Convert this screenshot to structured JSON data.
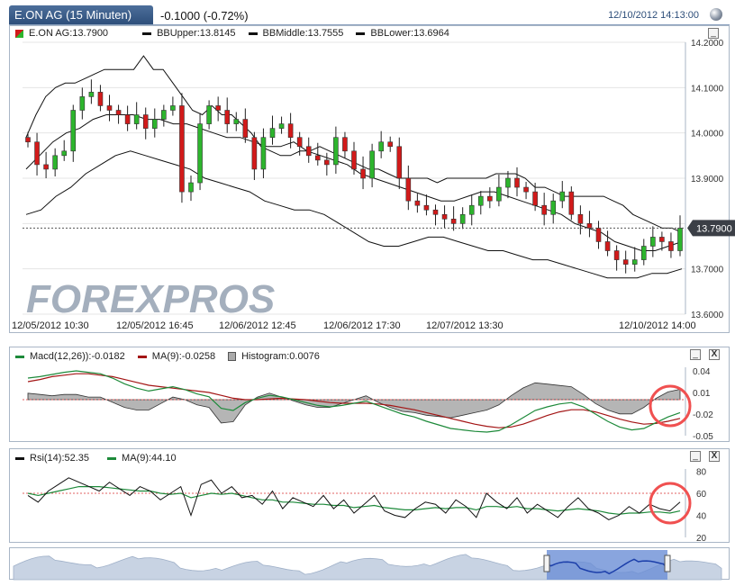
{
  "header": {
    "title": "E.ON AG (15 Minuten)",
    "change": "-0.1000 (-0.72%)",
    "timestamp": "12/10/2012 14:13:00"
  },
  "main": {
    "legend": [
      {
        "label": "E.ON AG:13.7900"
      },
      {
        "label": "BBUpper:13.8145"
      },
      {
        "label": "BBMiddle:13.7555"
      },
      {
        "label": "BBLower:13.6964"
      }
    ],
    "yticks": [
      "14.2000",
      "14.1000",
      "14.0000",
      "13.9000",
      "13.7000",
      "13.6000"
    ],
    "xticks": [
      "12/05/2012 10:30",
      "12/05/2012 16:45",
      "12/06/2012 12:45",
      "12/06/2012 17:30",
      "12/07/2012 13:30",
      "12/10/2012 14:00"
    ],
    "last_price": "13.7900",
    "watermark": "FOREXPROS",
    "minimize": "_"
  },
  "macd": {
    "legend": [
      {
        "label": "Macd(12,26)):-0.0182"
      },
      {
        "label": "MA(9):-0.0258"
      },
      {
        "label": "Histogram:0.0076"
      }
    ],
    "yticks": [
      "0.04",
      "0.01",
      "-0.02",
      "-0.05"
    ],
    "minimize": "_",
    "close": "X"
  },
  "rsi": {
    "legend": [
      {
        "label": "Rsi(14):52.35"
      },
      {
        "label": "MA(9):44.10"
      }
    ],
    "yticks": [
      "80",
      "60",
      "40",
      "20"
    ],
    "minimize": "_",
    "close": "X"
  },
  "chart_data": [
    {
      "type": "candlestick",
      "title": "E.ON AG (15 Minuten)",
      "ylim": [
        13.6,
        14.2
      ],
      "series": [
        {
          "name": "E.ON AG",
          "color": "#2db52d"
        },
        {
          "name": "BBUpper",
          "color": "#111"
        },
        {
          "name": "BBMiddle",
          "color": "#111"
        },
        {
          "name": "BBLower",
          "color": "#111"
        }
      ],
      "x_labels": [
        "12/05/2012 10:30",
        "12/05/2012 16:45",
        "12/06/2012 12:45",
        "12/06/2012 17:30",
        "12/07/2012 13:30",
        "12/10/2012 14:00"
      ],
      "close": [
        13.98,
        13.93,
        13.92,
        13.95,
        13.96,
        14.05,
        14.08,
        14.09,
        14.06,
        14.05,
        14.04,
        14.02,
        14.04,
        14.01,
        14.03,
        14.05,
        14.06,
        13.87,
        13.89,
        14.02,
        14.06,
        14.05,
        14.02,
        14.03,
        13.99,
        13.92,
        13.99,
        14.01,
        14.02,
        13.99,
        13.97,
        13.95,
        13.94,
        13.93,
        13.99,
        13.96,
        13.92,
        13.9,
        13.96,
        13.98,
        13.97,
        13.9,
        13.85,
        13.84,
        13.83,
        13.82,
        13.81,
        13.8,
        13.82,
        13.84,
        13.86,
        13.85,
        13.88,
        13.9,
        13.88,
        13.87,
        13.84,
        13.82,
        13.85,
        13.87,
        13.82,
        13.8,
        13.79,
        13.76,
        13.74,
        13.72,
        13.71,
        13.72,
        13.75,
        13.77,
        13.76,
        13.74,
        13.79
      ],
      "bb_upper": [
        13.99,
        14.04,
        14.08,
        14.1,
        14.11,
        14.11,
        14.12,
        14.13,
        14.14,
        14.14,
        14.14,
        14.14,
        14.17,
        14.14,
        14.14,
        14.11,
        14.08,
        14.05,
        14.04,
        14.06,
        14.04,
        14.04,
        14.02,
        14.0,
        13.97,
        13.96,
        13.95,
        13.95,
        13.96,
        13.96,
        13.97,
        13.96,
        13.95,
        13.94,
        13.93,
        13.92,
        13.92,
        13.91,
        13.9,
        13.9,
        13.9,
        13.9,
        13.89,
        13.9,
        13.9,
        13.9,
        13.9,
        13.9,
        13.91,
        13.91,
        13.91,
        13.9,
        13.88,
        13.88,
        13.87,
        13.86,
        13.86,
        13.86,
        13.86,
        13.86,
        13.85,
        13.84,
        13.82,
        13.81,
        13.8,
        13.79,
        13.79,
        13.78
      ],
      "bb_middle": [
        13.92,
        13.95,
        13.98,
        14.0,
        14.01,
        14.03,
        14.04,
        14.04,
        14.04,
        14.03,
        14.03,
        14.02,
        14.02,
        14.01,
        14.0,
        13.99,
        13.99,
        13.98,
        13.97,
        13.97,
        13.98,
        13.96,
        13.95,
        13.94,
        13.93,
        13.91,
        13.9,
        13.89,
        13.88,
        13.87,
        13.86,
        13.85,
        13.85,
        13.86,
        13.87,
        13.87,
        13.86,
        13.85,
        13.84,
        13.83,
        13.82,
        13.8,
        13.79,
        13.78,
        13.76,
        13.75,
        13.74,
        13.74,
        13.75,
        13.76
      ],
      "bb_lower": [
        13.82,
        13.83,
        13.86,
        13.88,
        13.91,
        13.93,
        13.95,
        13.96,
        13.95,
        13.94,
        13.93,
        13.92,
        13.9,
        13.89,
        13.88,
        13.87,
        13.85,
        13.84,
        13.83,
        13.83,
        13.82,
        13.8,
        13.78,
        13.76,
        13.75,
        13.75,
        13.76,
        13.77,
        13.77,
        13.76,
        13.75,
        13.74,
        13.74,
        13.73,
        13.72,
        13.72,
        13.71,
        13.7,
        13.69,
        13.68,
        13.68,
        13.68,
        13.69,
        13.69,
        13.7
      ]
    },
    {
      "type": "line",
      "title": "",
      "ylim": [
        -0.05,
        0.045
      ],
      "series": [
        {
          "name": "Macd(12,26))",
          "color": "#1d8a3a"
        },
        {
          "name": "MA(9)",
          "color": "#a31515"
        },
        {
          "name": "Histogram",
          "color": "#888"
        }
      ]
    },
    {
      "type": "line",
      "title": "",
      "ylim": [
        20,
        82
      ],
      "series": [
        {
          "name": "Rsi(14)",
          "color": "#111"
        },
        {
          "name": "MA(9)",
          "color": "#1d8a3a"
        }
      ]
    }
  ]
}
